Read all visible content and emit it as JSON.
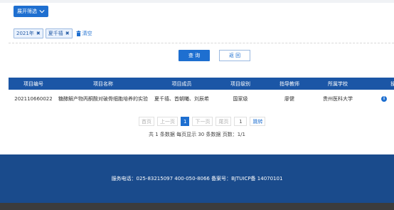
{
  "filter": {
    "toggle_label": "展开筛选"
  },
  "chips": [
    {
      "label": "2021年"
    },
    {
      "label": "夏千禧"
    }
  ],
  "clear_label": "清空",
  "buttons": {
    "search": "查 询",
    "back": "返 回"
  },
  "table": {
    "headers": [
      "项目编号",
      "项目名称",
      "项目成员",
      "项目级别",
      "指导教师",
      "所属学校",
      "操"
    ],
    "rows": [
      [
        "202110660022",
        "糖酵解产物丙酮酸对破骨细胞培养的实验研究",
        "夏千禧、首朝曦、刘辰希",
        "国家级",
        "廖健",
        "贵州医科大学",
        "i"
      ]
    ]
  },
  "pagination": {
    "first": "首页",
    "prev": "上一页",
    "current": "1",
    "next": "下一页",
    "last": "尾页",
    "input_value": "1",
    "go": "跳转",
    "summary": "共 1 条数据   每页显示 30 条数据   页数：1/1"
  },
  "footer": {
    "text": "服务电话：025-83215097 400-050-8066     备案号：BJTUICP备 14070101"
  },
  "colors": {
    "primary": "#1e6fd0",
    "header_blue": "#1b56a6",
    "footer_blue": "#1a4b8c"
  }
}
